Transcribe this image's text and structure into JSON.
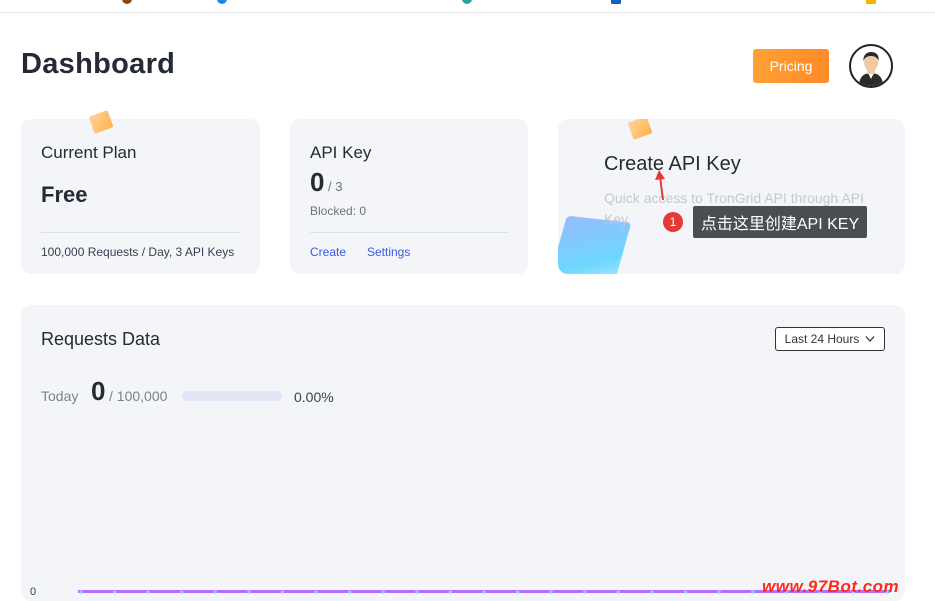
{
  "header": {
    "page_title": "Dashboard",
    "pricing_label": "Pricing"
  },
  "current_plan": {
    "title": "Current Plan",
    "plan": "Free",
    "details": "100,000 Requests / Day, 3 API Keys"
  },
  "api_key": {
    "title": "API Key",
    "count": "0",
    "max": "/ 3",
    "blocked": "Blocked: 0",
    "create_label": "Create",
    "settings_label": "Settings"
  },
  "create_card": {
    "title": "Create API Key",
    "description": "Quick access to TronGrid API through API Key"
  },
  "annotation": {
    "badge": "1",
    "text": "点击这里创建API KEY"
  },
  "requests": {
    "title": "Requests Data",
    "range_label": "Last 24 Hours",
    "today_label": "Today",
    "today_count": "0",
    "today_max": "/ 100,000",
    "percent": "0.00%",
    "progress_fraction": 0,
    "y_axis_zero": "0"
  },
  "chart_data": {
    "type": "line",
    "series": [
      {
        "values": [
          0,
          0,
          0,
          0,
          0,
          0,
          0,
          0,
          0,
          0,
          0,
          0,
          0,
          0,
          0,
          0,
          0,
          0,
          0,
          0,
          0,
          0,
          0,
          0,
          0
        ]
      }
    ],
    "color": "#b66dff"
  },
  "watermark": "www.97Bot.com",
  "icons": {
    "avatar": "user-avatar-icon",
    "dropdown": "chevron-down-icon"
  }
}
